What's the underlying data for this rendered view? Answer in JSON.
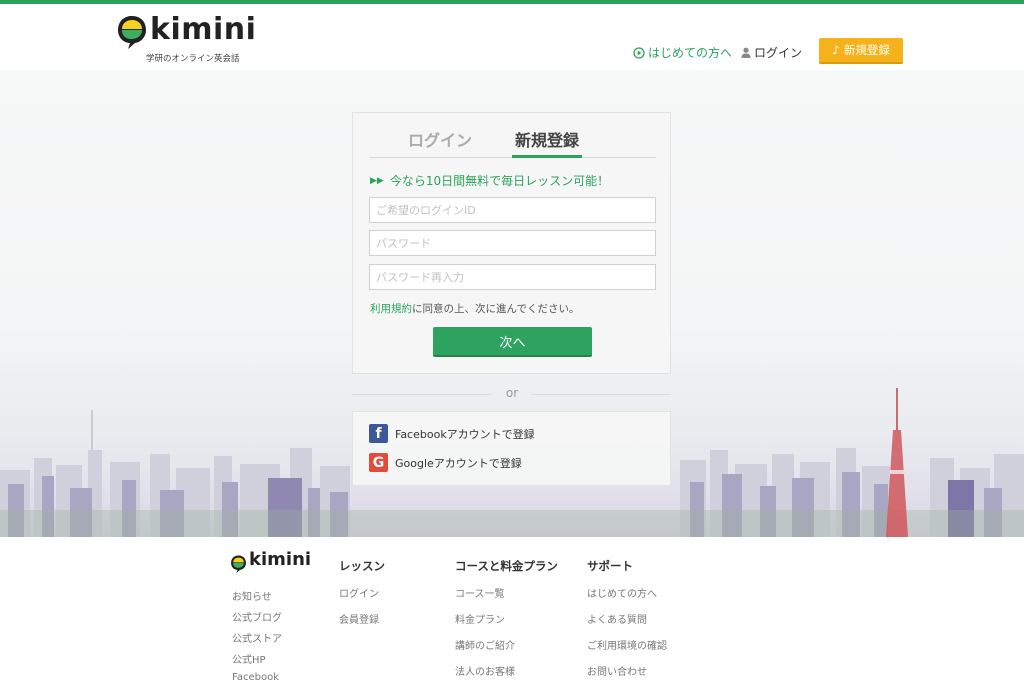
{
  "header": {
    "logo_text": "kimini",
    "tagline": "学研のオンライン英会話",
    "nav_first": "はじめての方へ",
    "nav_login": "ログイン",
    "nav_signup": "新規登録"
  },
  "form": {
    "tab_login": "ログイン",
    "tab_signup": "新規登録",
    "promo": "今なら10日間無料で毎日レッスン可能！",
    "login_id_placeholder": "ご希望のログインID",
    "password_placeholder": "パスワード",
    "password_confirm_placeholder": "パスワード再入力",
    "terms_link": "利用規約",
    "terms_text": "に同意の上、次に進んでください。",
    "next_button": "次へ",
    "or": "or",
    "facebook": "Facebookアカウントで登録",
    "google": "Googleアカウントで登録"
  },
  "footer": {
    "logo_text": "kimini",
    "col1": [
      "お知らせ",
      "公式ブログ",
      "公式ストア",
      "公式HP",
      "Facebook"
    ],
    "col2": {
      "heading": "レッスン",
      "items": [
        "ログイン",
        "会員登録"
      ]
    },
    "col3": {
      "heading": "コースと料金プラン",
      "items": [
        "コース一覧",
        "料金プラン",
        "講師のご紹介",
        "法人のお客様"
      ]
    },
    "col4": {
      "heading": "サポート",
      "items": [
        "はじめての方へ",
        "よくある質問",
        "ご利用環境の確認",
        "お問い合わせ"
      ]
    }
  },
  "colors": {
    "brand_green": "#2aa35b",
    "signup_orange": "#f5b21a",
    "facebook_blue": "#3b5998",
    "google_red": "#e34b3b"
  },
  "icons": [
    "play-circle-icon",
    "user-icon",
    "music-note-icon",
    "double-arrow-icon",
    "facebook-icon",
    "google-icon",
    "kimini-logo-icon"
  ]
}
